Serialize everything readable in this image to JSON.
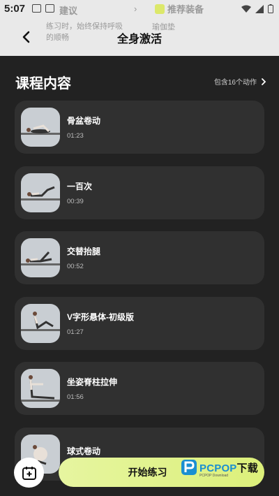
{
  "status_bar": {
    "time": "5:07"
  },
  "overlay": {
    "left_label": "建议",
    "right_label": "推荐装备",
    "left_text": "练习时，始终保持呼吸的顺畅",
    "right_text": "瑜伽垫"
  },
  "header": {
    "title": "全身激活"
  },
  "section": {
    "title": "课程内容",
    "meta": "包含16个动作"
  },
  "exercises": [
    {
      "name": "骨盆卷动",
      "duration": "01:23"
    },
    {
      "name": "一百次",
      "duration": "00:39"
    },
    {
      "name": "交替抬腿",
      "duration": "00:52"
    },
    {
      "name": "V字形悬体-初级版",
      "duration": "01:27"
    },
    {
      "name": "坐姿脊柱拉伸",
      "duration": "01:56"
    },
    {
      "name": "球式卷动",
      "duration": ""
    }
  ],
  "actions": {
    "start": "开始练习"
  },
  "watermark": {
    "brand": "PCPOP",
    "suffix": "下载",
    "sub": "PCPOP Download"
  },
  "colors": {
    "accent": "#dcf07a",
    "card": "#303030",
    "background": "#222222"
  }
}
